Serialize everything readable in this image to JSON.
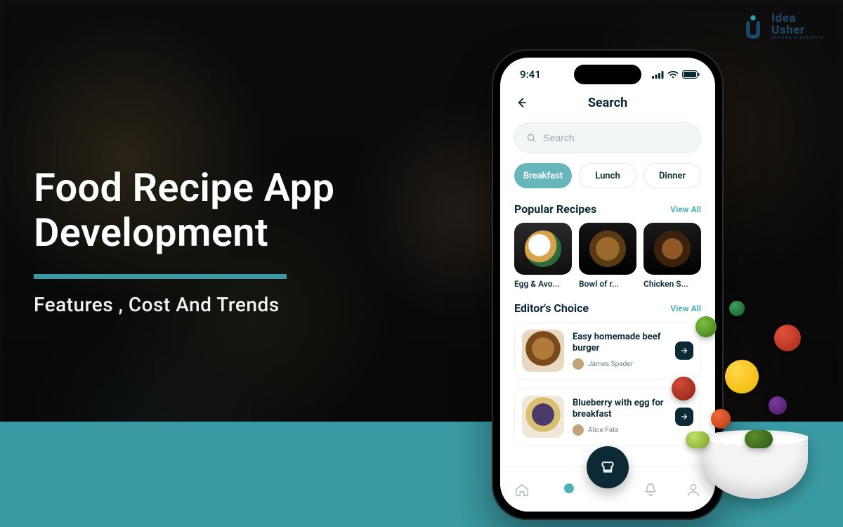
{
  "brand": {
    "line1": "Idea",
    "line2": "Usher",
    "tagline": "USHERING IN INNOVATION"
  },
  "headline": {
    "line1": "Food Recipe App",
    "line2": "Development",
    "sub": "Features , Cost And Trends"
  },
  "colors": {
    "accent": "#3a9aa3",
    "pillActive": "#66b6bb",
    "darkNavy": "#0b2a36"
  },
  "app": {
    "status": {
      "time": "9:41"
    },
    "screen_title": "Search",
    "search": {
      "placeholder": "Search"
    },
    "categories": [
      {
        "label": "Breakfast",
        "active": true
      },
      {
        "label": "Lunch",
        "active": false
      },
      {
        "label": "Dinner",
        "active": false
      }
    ],
    "popular": {
      "title": "Popular Recipes",
      "view_all": "View All",
      "items": [
        {
          "name": "Egg & Avo..."
        },
        {
          "name": "Bowl of r..."
        },
        {
          "name": "Chicken S..."
        }
      ]
    },
    "editors": {
      "title": "Editor's Choice",
      "view_all": "View All",
      "items": [
        {
          "title": "Easy homemade beef burger",
          "author": "James Spader"
        },
        {
          "title": "Blueberry with egg for breakfast",
          "author": "Alice Fala"
        }
      ]
    },
    "tabs": {
      "icons": [
        "home-icon",
        "explore-icon",
        "chef-icon",
        "bell-icon",
        "profile-icon"
      ]
    }
  }
}
